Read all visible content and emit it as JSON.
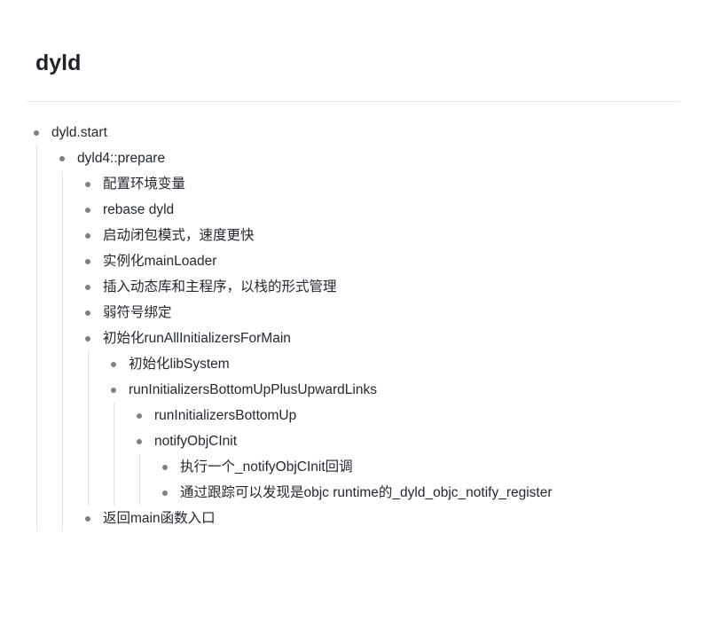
{
  "page": {
    "title": "dyld"
  },
  "outline": {
    "root": {
      "label": "dyld.start",
      "prepare": {
        "label": "dyld4::prepare",
        "items": {
          "i0": "配置环境变量",
          "i1": "rebase dyld",
          "i2": "启动闭包模式，速度更快",
          "i3": "实例化mainLoader",
          "i4": "插入动态库和主程序，以栈的形式管理",
          "i5": "弱符号绑定",
          "i6": {
            "label": "初始化runAllInitializersForMain",
            "c0": "初始化libSystem",
            "c1": {
              "label": "runInitializersBottomUpPlusUpwardLinks",
              "d0": "runInitializersBottomUp",
              "d1": {
                "label": "notifyObjCInit",
                "e0": "执行一个_notifyObjCInit回调",
                "e1": "通过跟踪可以发现是objc runtime的_dyld_objc_notify_register"
              }
            }
          },
          "i7": "返回main函数入口"
        }
      }
    }
  }
}
